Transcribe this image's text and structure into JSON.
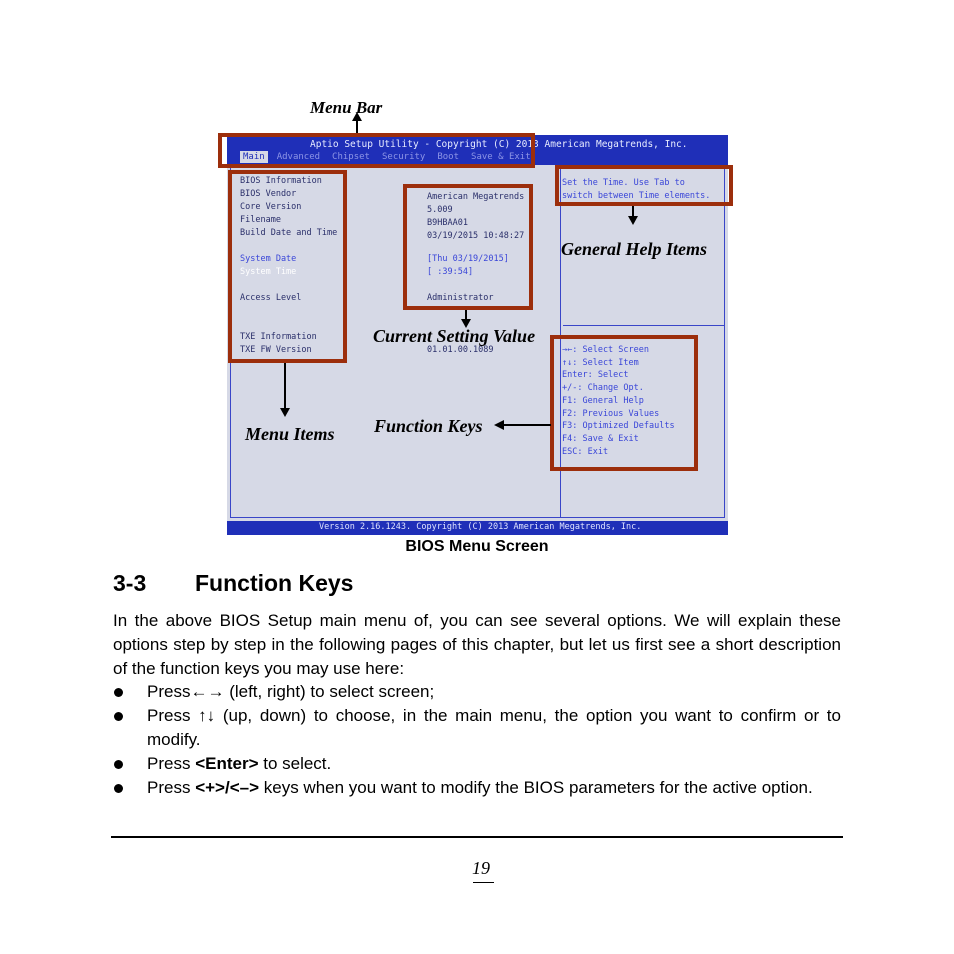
{
  "annotations": {
    "menu_bar": "Menu Bar",
    "general_help_items": "General Help Items",
    "current_setting_value": "Current Setting Value",
    "menu_items": "Menu Items",
    "function_keys": "Function Keys"
  },
  "bios": {
    "title": "Aptio Setup Utility - Copyright (C) 2013 American Megatrends, Inc.",
    "tabs": [
      "Main",
      "Advanced",
      "Chipset",
      "Security",
      "Boot",
      "Save & Exit"
    ],
    "active_tab": "Main",
    "menu_items": {
      "bios_information": "BIOS Information",
      "bios_vendor": "BIOS Vendor",
      "core_version": "Core Version",
      "filename": "Filename",
      "build_date": "Build Date and Time",
      "system_date": "System Date",
      "system_time": "System Time",
      "access_level": "Access Level",
      "txe_information": "TXE Information",
      "txe_fw_version": "TXE FW Version"
    },
    "values": {
      "vendor": "American Megatrends",
      "core_version": "5.009",
      "filename": "B9HBAA01",
      "build_date": "03/19/2015 10:48:27",
      "system_date": "[Thu 03/19/2015]",
      "system_time": "[ :39:54]",
      "access_level": "Administrator",
      "txe_fw_version": "01.01.00.1089"
    },
    "help": [
      "Set the Time. Use Tab to",
      "switch between Time elements."
    ],
    "keys": [
      "→←: Select Screen",
      "↑↓: Select Item",
      "Enter: Select",
      "+/-: Change Opt.",
      "F1: General Help",
      "F2: Previous Values",
      "F3: Optimized Defaults",
      "F4: Save & Exit",
      "ESC: Exit"
    ],
    "footer": "Version 2.16.1243. Copyright (C) 2013 American Megatrends, Inc."
  },
  "caption": "BIOS Menu Screen",
  "section": {
    "number": "3-3",
    "title": "Function Keys"
  },
  "intro": "In the above BIOS Setup main menu of, you can see several options. We will explain these options step by step in the following pages of this chapter, but let us first see a short description of the function keys you may use here:",
  "bullets": [
    {
      "prefix": "Press",
      "key": "←→",
      "bold": false,
      "suffix": " (left, right) to select screen;"
    },
    {
      "prefix": "Press ",
      "key": "↑↓",
      "bold": false,
      "suffix": " (up, down) to choose, in the main menu, the option you want to confirm or to modify."
    },
    {
      "prefix": "Press ",
      "key": "<Enter>",
      "bold": true,
      "suffix": " to select."
    },
    {
      "prefix": "Press ",
      "key": "<+>/<–>",
      "bold": true,
      "suffix": " keys when you want to modify the BIOS parameters for the active option."
    }
  ],
  "page_number": "19"
}
